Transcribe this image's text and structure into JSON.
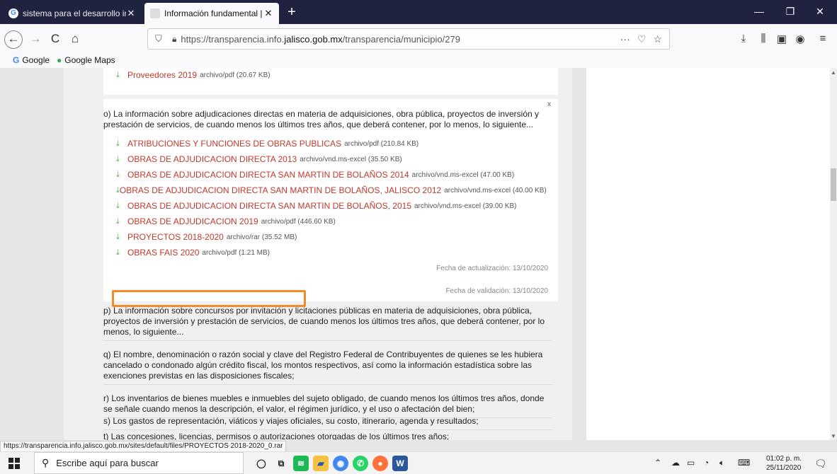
{
  "tabs": [
    {
      "title": "sistema para el desarrollo integ",
      "close": "✕"
    },
    {
      "title": "Información fundamental | Por",
      "close": "✕"
    }
  ],
  "new_tab": "+",
  "window_controls": {
    "minimize": "—",
    "maximize": "❐",
    "close": "✕"
  },
  "nav": {
    "back": "←",
    "forward": "→",
    "reload": "C",
    "home": "⌂"
  },
  "url": {
    "prefix": "https://transparencia.info.",
    "domain": "jalisco.gob.mx",
    "suffix": "/transparencia/municipio/279",
    "more": "···"
  },
  "bookmarks": [
    {
      "icon": "G",
      "label": "Google"
    },
    {
      "icon": "●",
      "label": "Google Maps"
    }
  ],
  "card_top": {
    "file": {
      "name": "Proveedores 2019",
      "meta": "archivo/pdf (20.67 KB)"
    }
  },
  "section_o": {
    "close": "x",
    "description": "o) La información sobre adjudicaciones directas en materia de adquisiciones, obra pública, proyectos de inversión y prestación de servicios, de cuando menos los últimos tres años, que deberá contener, por lo menos, lo siguiente...",
    "files": [
      {
        "name": "ATRIBUCIONES Y FUNCIONES DE OBRAS PUBLICAS",
        "meta": "archivo/pdf (210.84 KB)"
      },
      {
        "name": "OBRAS DE ADJUDICACION DIRECTA 2013",
        "meta": "archivo/vnd.ms-excel (35.50 KB)"
      },
      {
        "name": "OBRAS DE ADJUDICACION DIRECTA SAN MARTIN DE BOLAÑOS 2014",
        "meta": "archivo/vnd.ms-excel (47.00 KB)"
      },
      {
        "name": "OBRAS DE ADJUDICACION DIRECTA SAN MARTIN DE BOLAÑOS, JALISCO 2012",
        "meta": "archivo/vnd.ms-excel (40.00 KB)"
      },
      {
        "name": "OBRAS DE ADJUDICACION DIRECTA SAN MARTIN DE BOLAÑOS, 2015",
        "meta": "archivo/vnd.ms-excel (39.00 KB)"
      },
      {
        "name": "OBRAS DE ADJUDICACION 2019",
        "meta": "archivo/pdf (446.60 KB)"
      },
      {
        "name": "PROYECTOS 2018-2020",
        "meta": "archivo/rar (35.52 MB)"
      },
      {
        "name": "OBRAS FAIS 2020",
        "meta": "archivo/pdf (1.21 MB)"
      }
    ],
    "updated": "Fecha de actualización: 13/10/2020",
    "validated": "Fecha de validación: 13/10/2020"
  },
  "sections": [
    "p) La información sobre concursos por invitación y licitaciones públicas en materia de adquisiciones, obra pública, proyectos de inversión y prestación de servicios, de cuando menos los últimos tres años, que deberá contener, por lo menos, lo siguiente...",
    "q) El nombre, denominación o razón social y clave del Registro Federal de Contribuyentes de quienes se les hubiera cancelado o condonado algún crédito fiscal, los montos respectivos, así como la información estadística sobre las exenciones previstas en las disposiciones fiscales;",
    "r) Los inventarios de bienes muebles e inmuebles del sujeto obligado, de cuando menos los últimos tres años, donde se señale cuando menos la descripción, el valor, el régimen jurídico, y el uso o afectación del bien;",
    "s) Los gastos de representación, viáticos y viajes oficiales, su costo, itinerario, agenda y resultados;",
    "t) Las concesiones, licencias, permisos o autorizaciones otorgadas de los últimos tres años;"
  ],
  "status_url": "https://transparencia.info.jalisco.gob.mx/sites/default/files/PROYECTOS 2018-2020_0.rar",
  "taskbar": {
    "search_placeholder": "Escribe aquí para buscar",
    "time": "01:02 p. m.",
    "date": "25/11/2020"
  },
  "colors": {
    "link": "#c0392b",
    "highlight": "#f28c28",
    "download_arrow": "#4caf50",
    "titlebar": "#202340"
  }
}
